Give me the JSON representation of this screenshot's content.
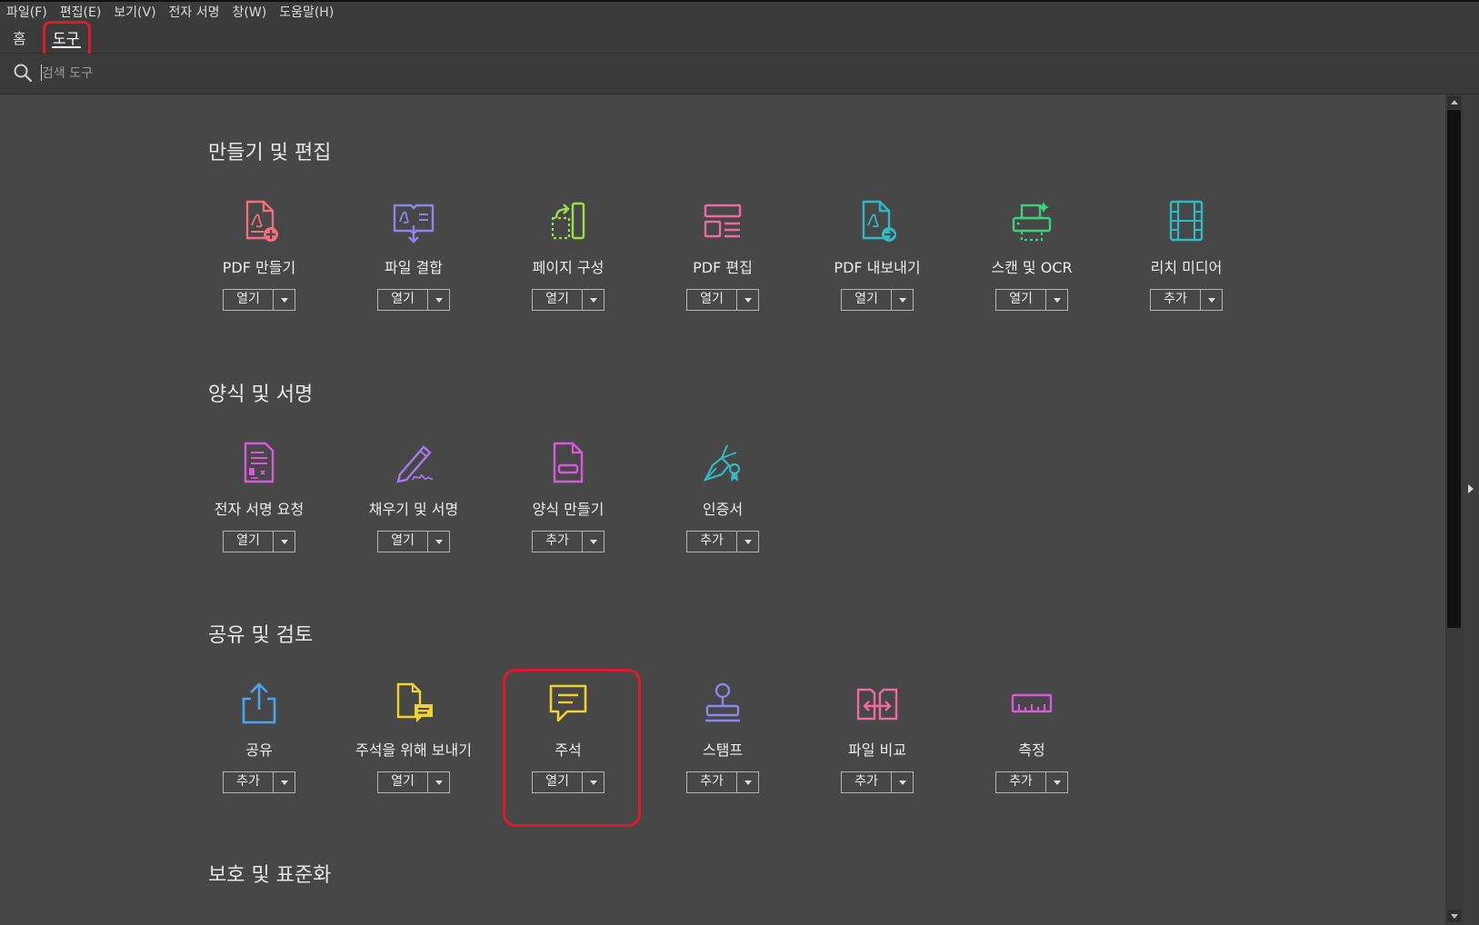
{
  "menu": [
    "파일(F)",
    "편집(E)",
    "보기(V)",
    "전자 서명",
    "창(W)",
    "도움말(H)"
  ],
  "tabs": {
    "home": "홈",
    "tools": "도구"
  },
  "search": {
    "placeholder": "검색 도구"
  },
  "sections": [
    {
      "title": "만들기 및 편집",
      "tools": [
        {
          "label": "PDF 만들기",
          "action": "열기",
          "icon": "create-pdf-icon",
          "color": "#f16e7d"
        },
        {
          "label": "파일 결합",
          "action": "열기",
          "icon": "combine-files-icon",
          "color": "#8d86ec"
        },
        {
          "label": "페이지 구성",
          "action": "열기",
          "icon": "organize-pages-icon",
          "color": "#9bdf4f"
        },
        {
          "label": "PDF 편집",
          "action": "열기",
          "icon": "edit-pdf-icon",
          "color": "#ee6aa0"
        },
        {
          "label": "PDF 내보내기",
          "action": "열기",
          "icon": "export-pdf-icon",
          "color": "#2fbac4"
        },
        {
          "label": "스캔 및 OCR",
          "action": "열기",
          "icon": "scan-ocr-icon",
          "color": "#3fd07a"
        },
        {
          "label": "리치 미디어",
          "action": "추가",
          "icon": "rich-media-icon",
          "color": "#2fbac4"
        }
      ]
    },
    {
      "title": "양식 및 서명",
      "tools": [
        {
          "label": "전자 서명 요청",
          "action": "열기",
          "icon": "request-signature-icon",
          "color": "#d65ad9"
        },
        {
          "label": "채우기 및 서명",
          "action": "열기",
          "icon": "fill-sign-icon",
          "color": "#a878ee"
        },
        {
          "label": "양식 만들기",
          "action": "추가",
          "icon": "prepare-form-icon",
          "color": "#d65ad9"
        },
        {
          "label": "인증서",
          "action": "추가",
          "icon": "certificate-icon",
          "color": "#2fbac4"
        }
      ]
    },
    {
      "title": "공유 및 검토",
      "tools": [
        {
          "label": "공유",
          "action": "추가",
          "icon": "share-icon",
          "color": "#4da3ee"
        },
        {
          "label": "주석을 위해 보내기",
          "action": "열기",
          "icon": "send-for-comments-icon",
          "color": "#f0d230"
        },
        {
          "label": "주석",
          "action": "열기",
          "icon": "comment-icon",
          "color": "#f0d230"
        },
        {
          "label": "스탬프",
          "action": "추가",
          "icon": "stamp-icon",
          "color": "#8d86ec"
        },
        {
          "label": "파일 비교",
          "action": "추가",
          "icon": "compare-files-icon",
          "color": "#ee6aa0"
        },
        {
          "label": "측정",
          "action": "추가",
          "icon": "measure-icon",
          "color": "#d65ad9"
        }
      ]
    },
    {
      "title": "보호 및 표준화",
      "tools": []
    }
  ]
}
